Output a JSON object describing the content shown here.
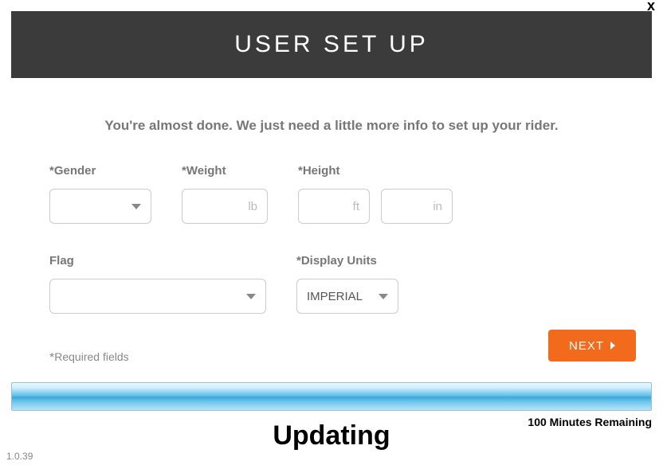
{
  "close_label": "x",
  "header": {
    "title": "USER SET UP"
  },
  "subtitle": "You're almost done. We just need a little more info to set up your rider.",
  "form": {
    "gender": {
      "label": "Gender",
      "required": true,
      "value": ""
    },
    "weight": {
      "label": "Weight",
      "required": true,
      "value": "",
      "unit": "lb"
    },
    "height": {
      "label": "Height",
      "required": true,
      "ft_value": "",
      "ft_unit": "ft",
      "in_value": "",
      "in_unit": "in"
    },
    "flag": {
      "label": "Flag",
      "required": false,
      "value": ""
    },
    "units": {
      "label": "Display Units",
      "required": true,
      "value": "IMPERIAL"
    }
  },
  "required_note": "Required fields",
  "next_label": "NEXT",
  "progress": {
    "status": "Updating",
    "remaining": "100 Minutes Remaining"
  },
  "version": "1.0.39"
}
